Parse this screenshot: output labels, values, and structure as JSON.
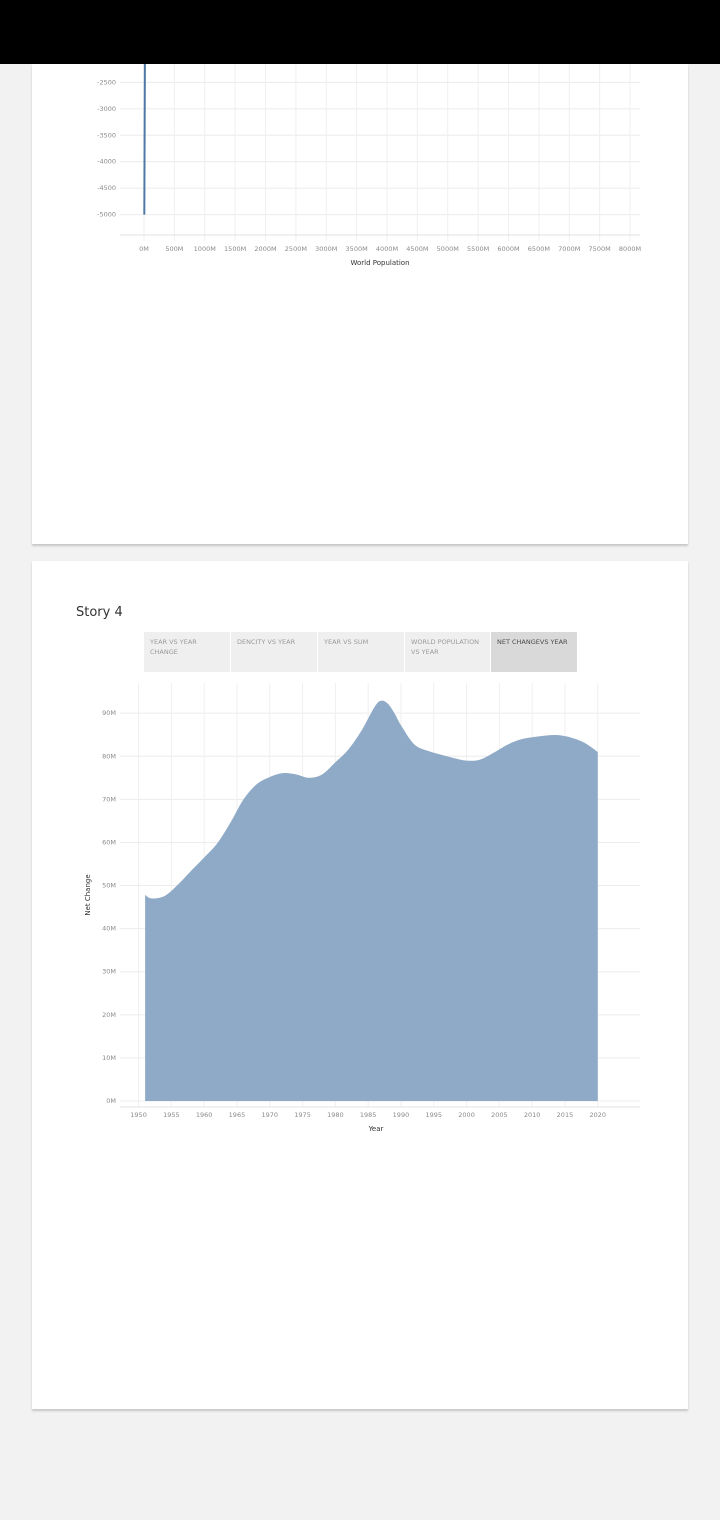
{
  "story": {
    "title": "Story 4",
    "tabs": [
      {
        "label": "YEAR VS YEAR CHANGE",
        "active": false
      },
      {
        "label": "DENCITY VS YEAR",
        "active": false
      },
      {
        "label": "YEAR VS SUM",
        "active": false
      },
      {
        "label": "WORLD POPULATION VS YEAR",
        "active": false
      },
      {
        "label": "NET CHANGEVS YEAR",
        "active": true
      }
    ]
  },
  "chart_data": [
    {
      "type": "line",
      "title": "",
      "xlabel": "World Population",
      "ylabel": "",
      "x_ticks": [
        "0M",
        "500M",
        "1000M",
        "1500M",
        "2000M",
        "2500M",
        "3000M",
        "3500M",
        "4000M",
        "4500M",
        "5000M",
        "5500M",
        "6000M",
        "6500M",
        "7000M",
        "7500M",
        "8000M"
      ],
      "y_ticks": [
        "-2500",
        "-3000",
        "-3500",
        "-4000",
        "-4500",
        "-5000"
      ],
      "xlim": [
        0,
        8000
      ],
      "visible_ylim": [
        -5500,
        -2000
      ],
      "series": [
        {
          "x": [
            5,
            15
          ],
          "y": [
            -5000,
            -2000
          ]
        }
      ],
      "grid": true,
      "color": "#4e79a7"
    },
    {
      "type": "area",
      "title": "",
      "xlabel": "Year",
      "ylabel": "Net Change",
      "x_ticks": [
        "1950",
        "1955",
        "1960",
        "1965",
        "1970",
        "1975",
        "1980",
        "1985",
        "1990",
        "1995",
        "2000",
        "2005",
        "2010",
        "2015",
        "2020"
      ],
      "y_ticks": [
        "0M",
        "10M",
        "20M",
        "30M",
        "40M",
        "50M",
        "60M",
        "70M",
        "80M",
        "90M"
      ],
      "xlim": [
        1949,
        2024
      ],
      "ylim": [
        0,
        97
      ],
      "x": [
        1951,
        1952,
        1954,
        1956,
        1958,
        1960,
        1962,
        1964,
        1966,
        1968,
        1970,
        1972,
        1974,
        1976,
        1978,
        1980,
        1982,
        1984,
        1986,
        1987,
        1988,
        1989,
        1990,
        1992,
        1994,
        1996,
        1998,
        2000,
        2002,
        2004,
        2006,
        2008,
        2010,
        2012,
        2014,
        2016,
        2018,
        2020
      ],
      "values": [
        47.8,
        47.0,
        47.6,
        50.2,
        53.4,
        56.5,
        59.8,
        64.6,
        70.0,
        73.5,
        75.2,
        76.1,
        75.8,
        75.0,
        75.8,
        78.6,
        81.6,
        86.0,
        91.5,
        92.9,
        92.2,
        90.0,
        87.2,
        82.8,
        81.3,
        80.4,
        79.6,
        79.0,
        79.2,
        80.7,
        82.5,
        83.8,
        84.4,
        84.8,
        84.9,
        84.3,
        83.1,
        81.0
      ],
      "grid": true,
      "color": "#8faac7"
    }
  ]
}
